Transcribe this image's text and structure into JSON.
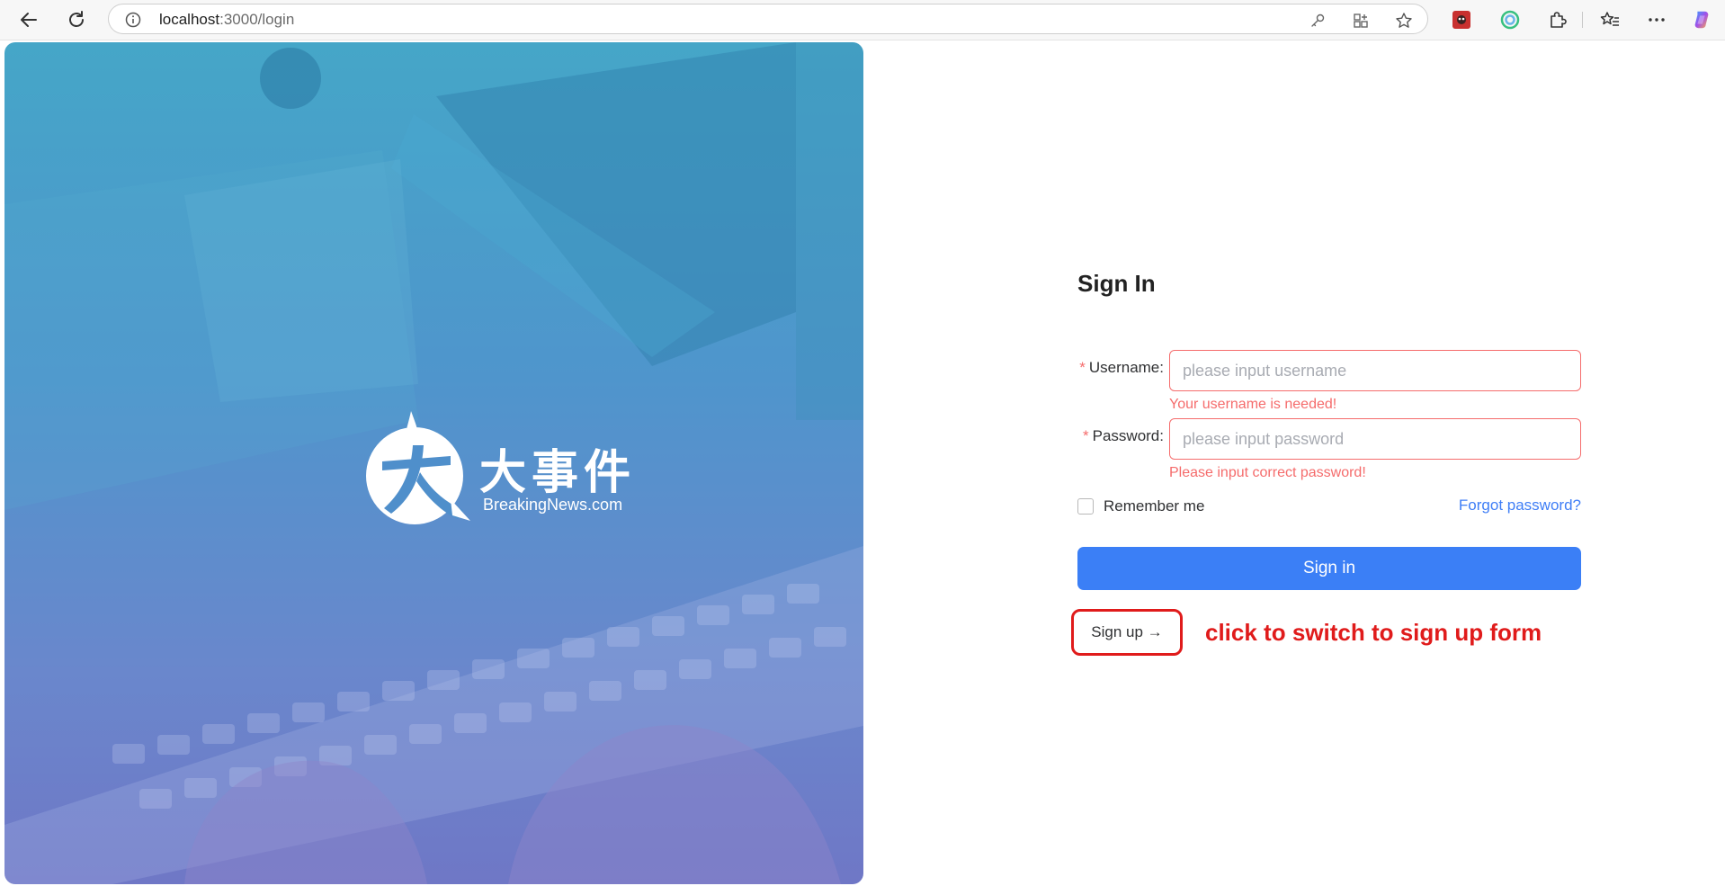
{
  "browser": {
    "url_host": "localhost",
    "url_path": ":3000/login"
  },
  "hero": {
    "logo_cn": "大事件",
    "logo_en": "BreakingNews.com"
  },
  "form": {
    "title": "Sign In",
    "username_label": "Username",
    "username_placeholder": "please input username",
    "username_error": "Your username is needed!",
    "password_label": "Password",
    "password_placeholder": "please input password",
    "password_error": "Please input correct password!",
    "remember_label": "Remember me",
    "remember_checked": false,
    "forgot_label": "Forgot password?",
    "signin_label": "Sign in",
    "signup_label": "Sign up →"
  },
  "annotation": {
    "text": "click to switch to sign up form"
  },
  "colors": {
    "accent": "#3b7ff6",
    "error": "#f56c6c",
    "annotation": "#e01b1b"
  }
}
